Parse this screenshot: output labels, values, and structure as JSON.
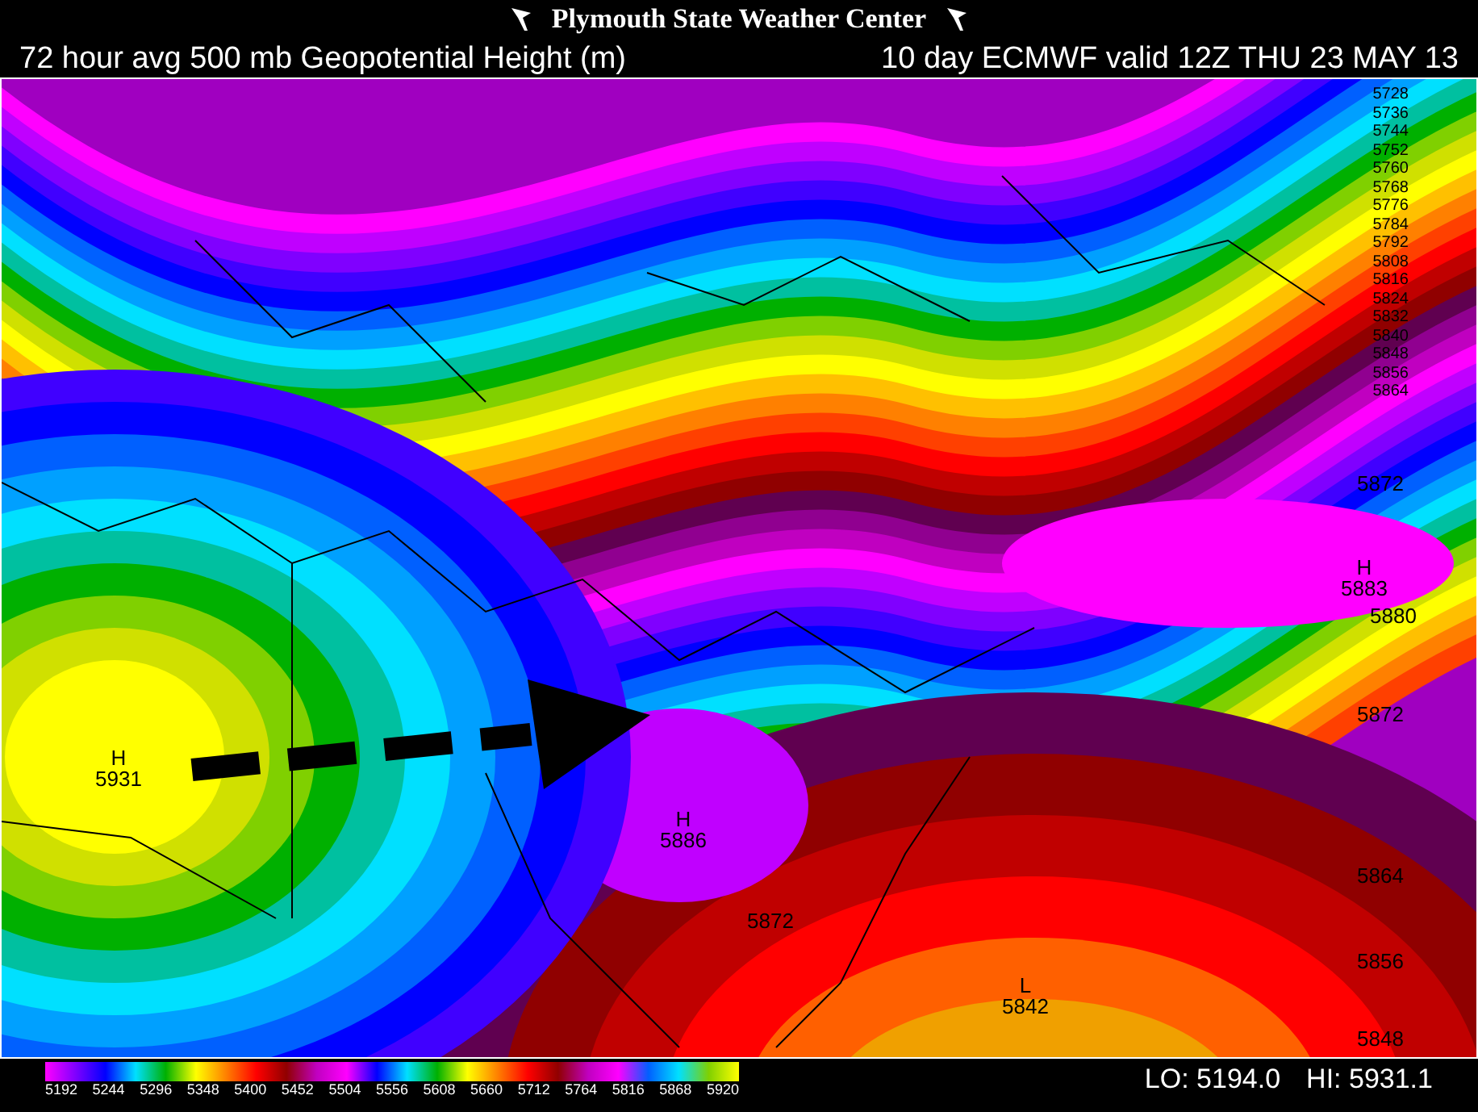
{
  "header": {
    "title": "Plymouth State Weather Center"
  },
  "subtitle": {
    "left": "72 hour avg 500 mb Geopotential Height (m)",
    "right": "10 day ECMWF valid 12Z THU 23 MAY 13"
  },
  "map": {
    "centers": [
      {
        "marker": "H",
        "value": "5931"
      },
      {
        "marker": "H",
        "value": "5886"
      },
      {
        "marker": "L",
        "value": "5842"
      },
      {
        "marker": "H",
        "value": "5883"
      }
    ],
    "contour_labels": [
      "5872",
      "5880",
      "5872",
      "5864",
      "5856",
      "5848",
      "5872"
    ],
    "edge_labels": [
      "5728",
      "5736",
      "5744",
      "5752",
      "5760",
      "5768",
      "5776",
      "5784",
      "5792",
      "5808",
      "5816",
      "5824",
      "5832",
      "5840",
      "5848",
      "5856",
      "5864"
    ]
  },
  "legend": {
    "ticks": [
      "5192",
      "5244",
      "5296",
      "5348",
      "5400",
      "5452",
      "5504",
      "5556",
      "5608",
      "5660",
      "5712",
      "5764",
      "5816",
      "5868",
      "5920"
    ]
  },
  "stats": {
    "lo": "LO: 5194.0",
    "hi": "HI: 5931.1"
  }
}
